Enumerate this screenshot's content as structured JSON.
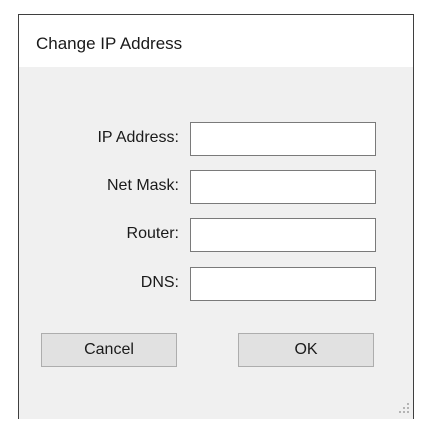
{
  "dialog": {
    "title": "Change IP Address"
  },
  "fields": [
    {
      "label": "IP Address:",
      "value": "",
      "placeholder": ""
    },
    {
      "label": "Net Mask:",
      "value": "",
      "placeholder": ""
    },
    {
      "label": "Router:",
      "value": "",
      "placeholder": ""
    },
    {
      "label": "DNS:",
      "value": "",
      "placeholder": ""
    }
  ],
  "buttons": {
    "cancel_label": "Cancel",
    "ok_label": "OK"
  }
}
